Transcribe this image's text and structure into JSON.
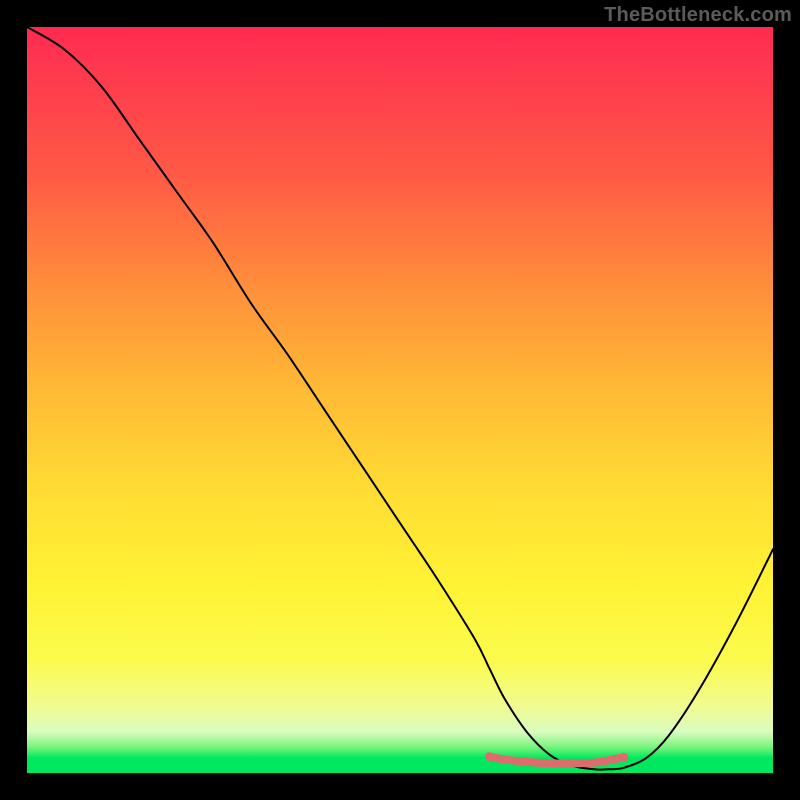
{
  "watermark": "TheBottleneck.com",
  "chart_data": {
    "type": "line",
    "title": "",
    "xlabel": "",
    "ylabel": "",
    "xlim": [
      0,
      100
    ],
    "ylim": [
      0,
      100
    ],
    "grid": false,
    "legend": false,
    "series": [
      {
        "name": "curve",
        "x": [
          0,
          5,
          10,
          15,
          20,
          25,
          30,
          35,
          40,
          45,
          50,
          55,
          60,
          62,
          64,
          67,
          70,
          73,
          76,
          78,
          80,
          83,
          86,
          90,
          95,
          100
        ],
        "y": [
          100,
          97,
          92,
          85,
          78,
          71,
          63,
          56,
          48.5,
          41,
          33.5,
          26,
          18,
          14,
          10,
          5.5,
          2.5,
          1,
          0.5,
          0.5,
          0.7,
          2,
          5,
          11,
          20,
          30
        ],
        "color": "#000000"
      },
      {
        "name": "highlight",
        "x": [
          62,
          64,
          67,
          70,
          73,
          76,
          78,
          80
        ],
        "y": [
          2.2,
          1.8,
          1.5,
          1.3,
          1.3,
          1.4,
          1.7,
          2.1
        ],
        "color": "#dd6d6d"
      }
    ],
    "background_gradient": {
      "stops": [
        {
          "pos": 0.0,
          "color": "#ff2a4f"
        },
        {
          "pos": 0.2,
          "color": "#ff5a45"
        },
        {
          "pos": 0.48,
          "color": "#ffb836"
        },
        {
          "pos": 0.75,
          "color": "#fff335"
        },
        {
          "pos": 0.95,
          "color": "#d9fcc0"
        },
        {
          "pos": 1.0,
          "color": "#00e85e"
        }
      ]
    }
  }
}
